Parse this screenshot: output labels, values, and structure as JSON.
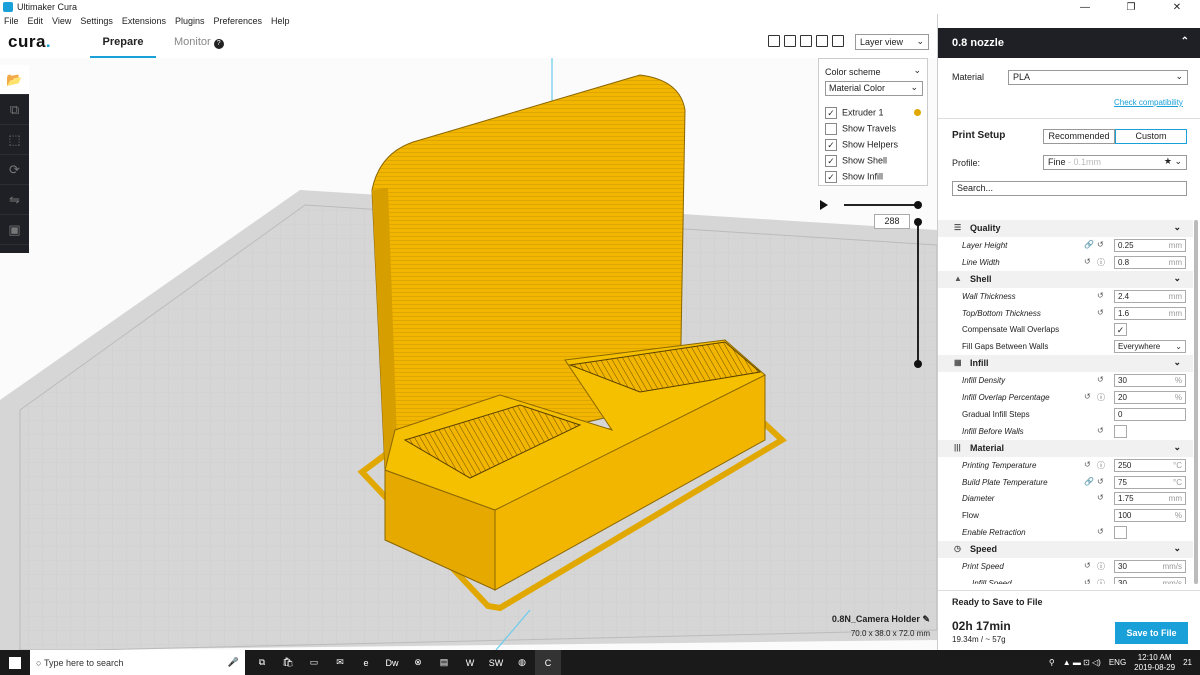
{
  "window": {
    "title": "Ultimaker Cura",
    "minimize": "—",
    "maximize": "❐",
    "close": "✕"
  },
  "menu": [
    "File",
    "Edit",
    "View",
    "Settings",
    "Extensions",
    "Plugins",
    "Preferences",
    "Help"
  ],
  "toolbar": {
    "logo": "cura",
    "logo_dot": ".",
    "tab_prepare": "Prepare",
    "tab_monitor": "Monitor",
    "view_mode": "Layer view"
  },
  "colorscheme": {
    "title": "Color scheme",
    "selected": "Material Color",
    "items": [
      {
        "label": "Extruder 1",
        "checked": true
      },
      {
        "label": "Show Travels",
        "checked": false
      },
      {
        "label": "Show Helpers",
        "checked": true
      },
      {
        "label": "Show Shell",
        "checked": true
      },
      {
        "label": "Show Infill",
        "checked": true
      }
    ],
    "extruder_color": "#e0a800"
  },
  "layer": {
    "current": "288"
  },
  "object": {
    "name": "0.8N_Camera Holder",
    "dims": "70.0 x 38.0 x 72.0 mm"
  },
  "right": {
    "nozzle": "0.8 nozzle",
    "material_label": "Material",
    "material": "PLA",
    "check_compat": "Check compatibility",
    "print_setup": "Print Setup",
    "recommended": "Recommended",
    "custom": "Custom",
    "profile_label": "Profile:",
    "profile": "Fine",
    "profile_sub": "- 0.1mm",
    "search_placeholder": "Search..."
  },
  "settings": [
    {
      "type": "cat",
      "label": "Quality",
      "icon": "quality-icon"
    },
    {
      "type": "field",
      "label": "Layer Height",
      "value": "0.25",
      "unit": "mm",
      "italic": true,
      "icons": "link-reset"
    },
    {
      "type": "field",
      "label": "Line Width",
      "value": "0.8",
      "unit": "mm",
      "italic": true,
      "icons": "reset-info"
    },
    {
      "type": "cat",
      "label": "Shell",
      "icon": "shell-icon"
    },
    {
      "type": "field",
      "label": "Wall Thickness",
      "value": "2.4",
      "unit": "mm",
      "italic": true,
      "icons": "reset"
    },
    {
      "type": "field",
      "label": "Top/Bottom Thickness",
      "value": "1.6",
      "unit": "mm",
      "italic": true,
      "icons": "reset"
    },
    {
      "type": "check",
      "label": "Compensate Wall Overlaps",
      "checked": true,
      "italic": false
    },
    {
      "type": "select",
      "label": "Fill Gaps Between Walls",
      "value": "Everywhere",
      "italic": false
    },
    {
      "type": "cat",
      "label": "Infill",
      "icon": "infill-icon"
    },
    {
      "type": "field",
      "label": "Infill Density",
      "value": "30",
      "unit": "%",
      "italic": true,
      "icons": "reset"
    },
    {
      "type": "field",
      "label": "Infill Overlap Percentage",
      "value": "20",
      "unit": "%",
      "italic": true,
      "icons": "reset-info"
    },
    {
      "type": "field",
      "label": "Gradual Infill Steps",
      "value": "0",
      "unit": "",
      "italic": false
    },
    {
      "type": "check",
      "label": "Infill Before Walls",
      "checked": false,
      "italic": true,
      "icons": "reset"
    },
    {
      "type": "cat",
      "label": "Material",
      "icon": "material-icon"
    },
    {
      "type": "field",
      "label": "Printing Temperature",
      "value": "250",
      "unit": "°C",
      "italic": true,
      "icons": "reset-info"
    },
    {
      "type": "field",
      "label": "Build Plate Temperature",
      "value": "75",
      "unit": "°C",
      "italic": true,
      "icons": "link-reset"
    },
    {
      "type": "field",
      "label": "Diameter",
      "value": "1.75",
      "unit": "mm",
      "italic": true,
      "icons": "reset"
    },
    {
      "type": "field",
      "label": "Flow",
      "value": "100",
      "unit": "%",
      "italic": false
    },
    {
      "type": "check",
      "label": "Enable Retraction",
      "checked": false,
      "italic": true,
      "icons": "reset"
    },
    {
      "type": "cat",
      "label": "Speed",
      "icon": "speed-icon"
    },
    {
      "type": "field",
      "label": "Print Speed",
      "value": "30",
      "unit": "mm/s",
      "italic": true,
      "icons": "reset-info"
    },
    {
      "type": "field",
      "label": "Infill Speed",
      "value": "30",
      "unit": "mm/s",
      "italic": true,
      "icons": "reset-info",
      "indent": true
    }
  ],
  "footer": {
    "ready": "Ready to Save to File",
    "time": "02h 17min",
    "length": "19.34m / ~ 57g",
    "save": "Save to File"
  },
  "taskbar": {
    "search": "Type here to search",
    "lang": "ENG",
    "time": "12:10 AM",
    "date": "2019-08-29",
    "notif": "21"
  }
}
